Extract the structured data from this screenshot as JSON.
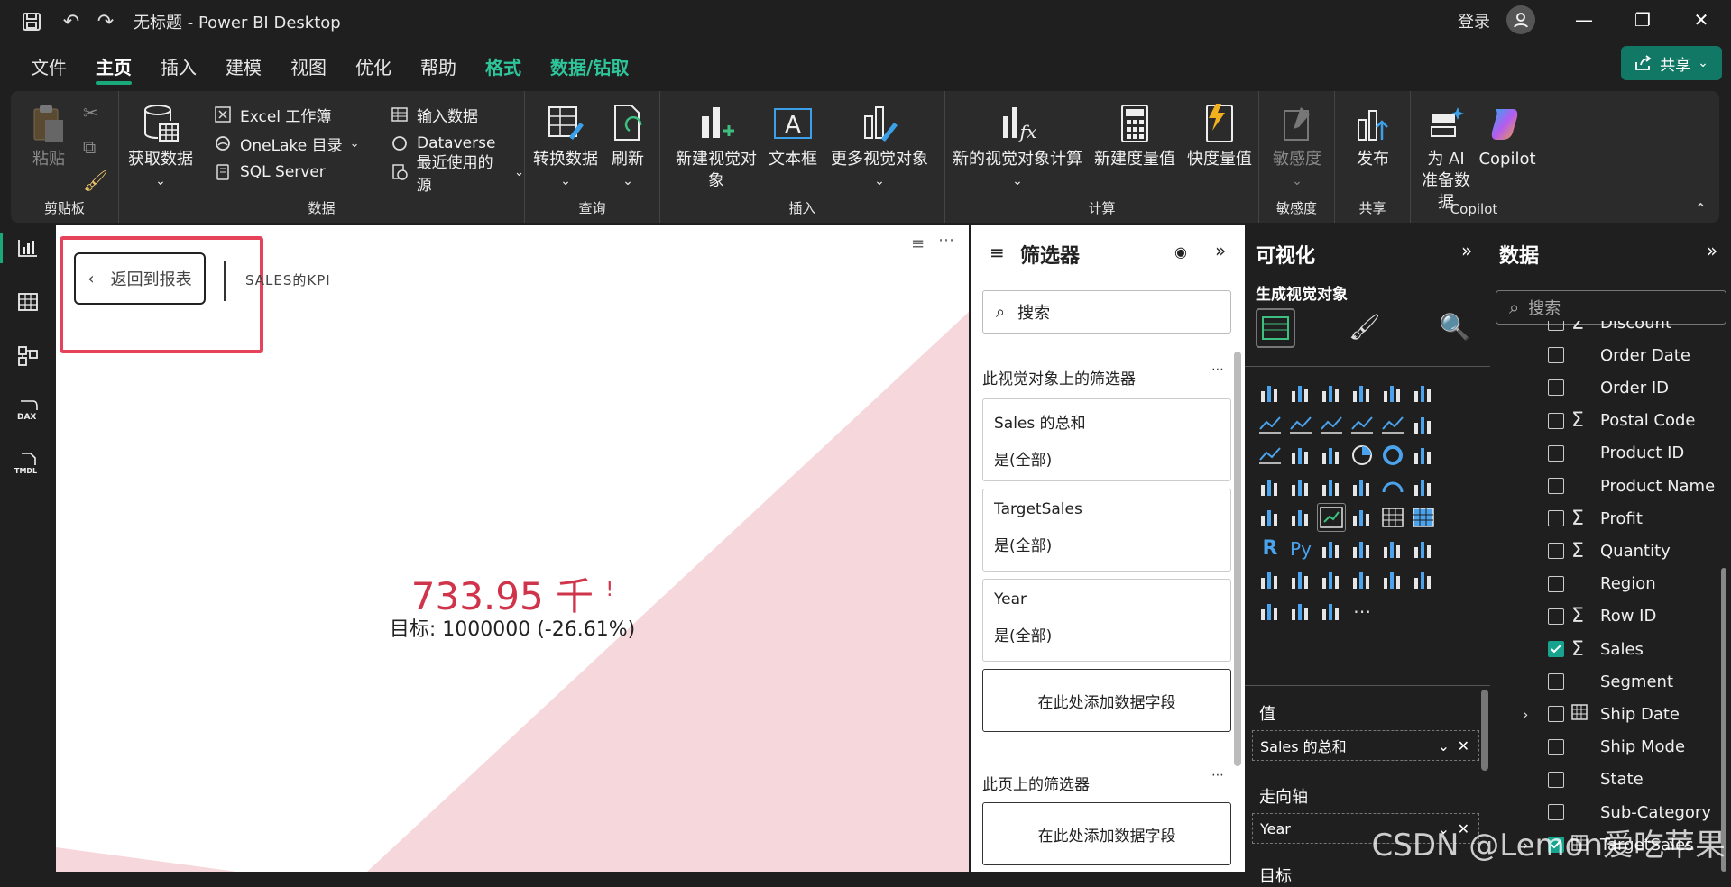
{
  "titlebar": {
    "title": "无标题 - Power BI Desktop",
    "signin": "登录"
  },
  "menu": {
    "tabs": [
      "文件",
      "主页",
      "插入",
      "建模",
      "视图",
      "优化",
      "帮助",
      "格式",
      "数据/钻取"
    ],
    "share": "共享"
  },
  "ribbon": {
    "clipboard": {
      "paste": "粘贴",
      "label": "剪贴板"
    },
    "data": {
      "get_data": "获取数据",
      "excel": "Excel 工作簿",
      "onelake": "OneLake 目录",
      "sql": "SQL Server",
      "enter": "输入数据",
      "dataverse": "Dataverse",
      "recent": "最近使用的源",
      "label": "数据"
    },
    "query": {
      "transform": "转换数据",
      "refresh": "刷新",
      "label": "查询"
    },
    "insert": {
      "new_visual": "新建视觉对象",
      "textbox": "文本框",
      "more_visuals": "更多视觉对象",
      "label": "插入"
    },
    "calc": {
      "new_visual_calc": "新的视觉对象计算",
      "new_measure": "新建度量值",
      "quick_measure": "快度量值",
      "label": "计算"
    },
    "sensitivity": {
      "btn": "敏感度",
      "label": "敏感度"
    },
    "share": {
      "publish": "发布",
      "label": "共享"
    },
    "copilot": {
      "prep_ai_1": "为 AI",
      "prep_ai_2": "准备数据",
      "copilot": "Copilot",
      "label": "Copilot"
    }
  },
  "canvas": {
    "back_button": "返回到报表",
    "kpi_title": "SALES的KPI",
    "kpi_value": "733.95 千",
    "kpi_alert": "!",
    "kpi_goal": "目标: 1000000 (-26.61%)"
  },
  "filters": {
    "title": "筛选器",
    "search_placeholder": "搜索",
    "visual_section": "此视觉对象上的筛选器",
    "cards": [
      {
        "title": "Sales 的总和",
        "state": "是(全部)"
      },
      {
        "title": "TargetSales",
        "state": "是(全部)"
      },
      {
        "title": "Year",
        "state": "是(全部)"
      }
    ],
    "add_field": "在此处添加数据字段",
    "page_section": "此页上的筛选器",
    "add_field_page": "在此处添加数据字段"
  },
  "viz": {
    "title": "可视化",
    "subtitle": "生成视觉对象",
    "value_label": "值",
    "value_field": "Sales 的总和",
    "trend_label": "走向轴",
    "trend_field": "Year",
    "goal_label": "目标"
  },
  "data": {
    "title": "数据",
    "search_placeholder": "搜索",
    "fields": [
      {
        "name": "Discount",
        "sigma": true,
        "checked": false,
        "table": false
      },
      {
        "name": "Order Date",
        "sigma": false,
        "checked": false,
        "table": false
      },
      {
        "name": "Order ID",
        "sigma": false,
        "checked": false,
        "table": false
      },
      {
        "name": "Postal Code",
        "sigma": true,
        "checked": false,
        "table": false
      },
      {
        "name": "Product ID",
        "sigma": false,
        "checked": false,
        "table": false
      },
      {
        "name": "Product Name",
        "sigma": false,
        "checked": false,
        "table": false
      },
      {
        "name": "Profit",
        "sigma": true,
        "checked": false,
        "table": false
      },
      {
        "name": "Quantity",
        "sigma": true,
        "checked": false,
        "table": false
      },
      {
        "name": "Region",
        "sigma": false,
        "checked": false,
        "table": false
      },
      {
        "name": "Row ID",
        "sigma": true,
        "checked": false,
        "table": false
      },
      {
        "name": "Sales",
        "sigma": true,
        "checked": true,
        "table": false
      },
      {
        "name": "Segment",
        "sigma": false,
        "checked": false,
        "table": false
      },
      {
        "name": "Ship Date",
        "sigma": false,
        "checked": false,
        "table": true
      },
      {
        "name": "Ship Mode",
        "sigma": false,
        "checked": false,
        "table": false
      },
      {
        "name": "State",
        "sigma": false,
        "checked": false,
        "table": false
      },
      {
        "name": "Sub-Category",
        "sigma": false,
        "checked": false,
        "table": false
      },
      {
        "name": "TargetSales",
        "sigma": false,
        "checked": true,
        "table": true
      }
    ]
  },
  "watermark": "CSDN @Lemon爱吃苹果",
  "colors": {
    "accent": "#18a87a",
    "kpi_red": "#d0344a",
    "share_bg": "#117865",
    "highlight_box": "#e6435a"
  }
}
